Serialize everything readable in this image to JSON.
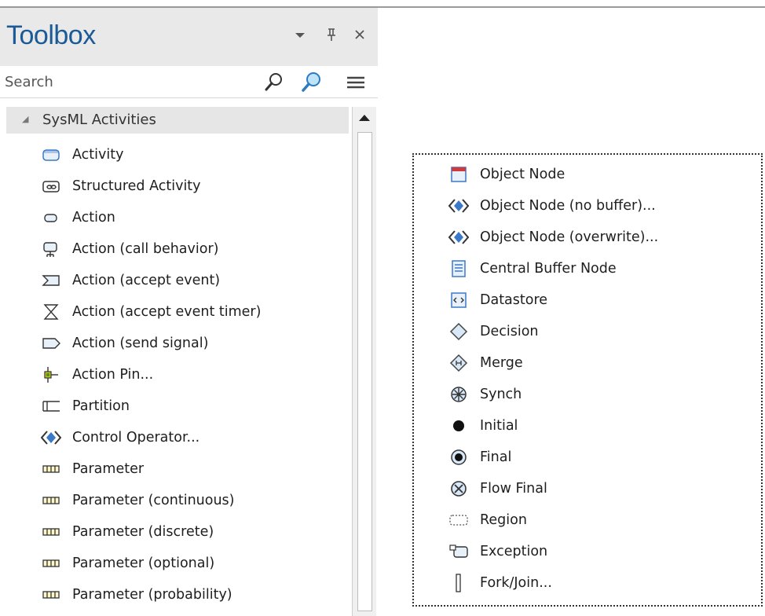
{
  "toolbox": {
    "title": "Toolbox",
    "search": {
      "placeholder": "Search",
      "value": ""
    },
    "group": {
      "label": "SysML Activities",
      "expanded": true
    },
    "left_items": [
      {
        "label": "Activity",
        "icon": "activity-icon"
      },
      {
        "label": "Structured Activity",
        "icon": "structured-activity-icon"
      },
      {
        "label": "Action",
        "icon": "action-icon"
      },
      {
        "label": "Action (call behavior)",
        "icon": "call-behavior-icon"
      },
      {
        "label": "Action (accept event)",
        "icon": "accept-event-icon"
      },
      {
        "label": "Action (accept event timer)",
        "icon": "hourglass-icon"
      },
      {
        "label": "Action (send signal)",
        "icon": "send-signal-icon"
      },
      {
        "label": "Action Pin...",
        "icon": "action-pin-icon"
      },
      {
        "label": "Partition",
        "icon": "partition-icon"
      },
      {
        "label": "Control Operator...",
        "icon": "control-operator-icon"
      },
      {
        "label": "Parameter",
        "icon": "parameter-icon"
      },
      {
        "label": "Parameter (continuous)",
        "icon": "parameter-icon"
      },
      {
        "label": "Parameter (discrete)",
        "icon": "parameter-icon"
      },
      {
        "label": "Parameter (optional)",
        "icon": "parameter-icon"
      },
      {
        "label": "Parameter (probability)",
        "icon": "parameter-icon"
      }
    ],
    "right_items": [
      {
        "label": "Object Node",
        "icon": "object-node-icon"
      },
      {
        "label": "Object Node (no buffer)...",
        "icon": "object-node-diamond-icon"
      },
      {
        "label": "Object Node (overwrite)...",
        "icon": "object-node-diamond-icon"
      },
      {
        "label": "Central Buffer Node",
        "icon": "central-buffer-icon"
      },
      {
        "label": "Datastore",
        "icon": "datastore-icon"
      },
      {
        "label": "Decision",
        "icon": "decision-icon"
      },
      {
        "label": "Merge",
        "icon": "merge-icon"
      },
      {
        "label": "Synch",
        "icon": "synch-icon"
      },
      {
        "label": "Initial",
        "icon": "initial-icon"
      },
      {
        "label": "Final",
        "icon": "final-icon"
      },
      {
        "label": "Flow Final",
        "icon": "flow-final-icon"
      },
      {
        "label": "Region",
        "icon": "region-icon"
      },
      {
        "label": "Exception",
        "icon": "exception-icon"
      },
      {
        "label": "Fork/Join...",
        "icon": "fork-join-icon"
      }
    ],
    "colors": {
      "title": "#1b5a96",
      "header_bg": "#e9e9e9",
      "icon_blue": "#3a78c8"
    }
  }
}
